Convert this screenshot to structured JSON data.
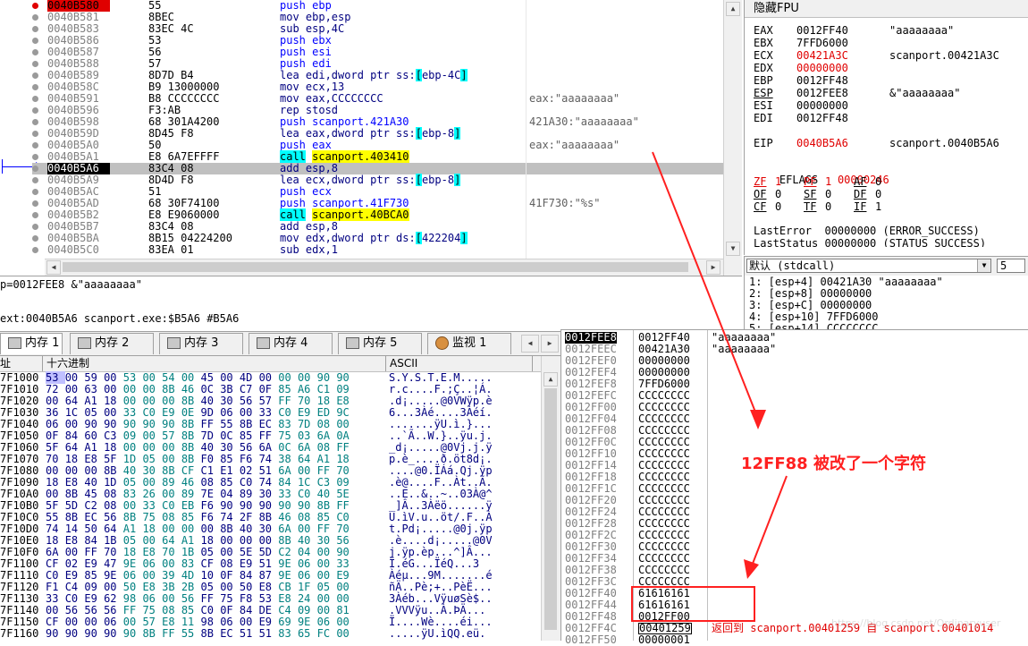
{
  "disasm": {
    "rows": [
      {
        "addr": "0040B580",
        "bytes": "55",
        "instr": "push ebp",
        "comment": ""
      },
      {
        "addr": "0040B581",
        "bytes": "8BEC",
        "instr": "mov ebp,esp",
        "comment": ""
      },
      {
        "addr": "0040B583",
        "bytes": "83EC 4C",
        "instr": "sub esp,4C",
        "comment": ""
      },
      {
        "addr": "0040B586",
        "bytes": "53",
        "instr": "push ebx",
        "comment": ""
      },
      {
        "addr": "0040B587",
        "bytes": "56",
        "instr": "push esi",
        "comment": ""
      },
      {
        "addr": "0040B588",
        "bytes": "57",
        "instr": "push edi",
        "comment": ""
      },
      {
        "addr": "0040B589",
        "bytes": "8D7D B4",
        "instr": "lea edi,dword ptr ss:[ebp-4C]",
        "comment": ""
      },
      {
        "addr": "0040B58C",
        "bytes": "B9 13000000",
        "instr": "mov ecx,13",
        "comment": ""
      },
      {
        "addr": "0040B591",
        "bytes": "B8 CCCCCCCC",
        "instr": "mov eax,CCCCCCCC",
        "comment": "eax:\"aaaaaaaa\""
      },
      {
        "addr": "0040B596",
        "bytes": "F3:AB",
        "instr": "rep stosd",
        "comment": ""
      },
      {
        "addr": "0040B598",
        "bytes": "68 301A4200",
        "instr": "push scanport.421A30",
        "comment": "421A30:\"aaaaaaaa\""
      },
      {
        "addr": "0040B59D",
        "bytes": "8D45 F8",
        "instr": "lea eax,dword ptr ss:[ebp-8]",
        "comment": ""
      },
      {
        "addr": "0040B5A0",
        "bytes": "50",
        "instr": "push eax",
        "comment": "eax:\"aaaaaaaa\""
      },
      {
        "addr": "0040B5A1",
        "bytes": "E8 6A7EFFFF",
        "instr": "call scanport.403410",
        "comment": ""
      },
      {
        "addr": "0040B5A6",
        "bytes": "83C4 08",
        "instr": "add esp,8",
        "comment": ""
      },
      {
        "addr": "0040B5A9",
        "bytes": "8D4D F8",
        "instr": "lea ecx,dword ptr ss:[ebp-8]",
        "comment": ""
      },
      {
        "addr": "0040B5AC",
        "bytes": "51",
        "instr": "push ecx",
        "comment": ""
      },
      {
        "addr": "0040B5AD",
        "bytes": "68 30F74100",
        "instr": "push scanport.41F730",
        "comment": "41F730:\"%s\""
      },
      {
        "addr": "0040B5B2",
        "bytes": "E8 E9060000",
        "instr": "call scanport.40BCA0",
        "comment": ""
      },
      {
        "addr": "0040B5B7",
        "bytes": "83C4 08",
        "instr": "add esp,8",
        "comment": ""
      },
      {
        "addr": "0040B5BA",
        "bytes": "8B15 04224200",
        "instr": "mov edx,dword ptr ds:[422204]",
        "comment": ""
      },
      {
        "addr": "0040B5C0",
        "bytes": "83EA 01",
        "instr": "sub edx,1",
        "comment": ""
      }
    ]
  },
  "info": {
    "line1": "p=0012FEE8 &\"aaaaaaaa\"",
    "line2": "ext:0040B5A6 scanport.exe:$B5A6 #B5A6"
  },
  "fpu": {
    "title": "隐藏FPU",
    "regs": [
      {
        "name": "EAX",
        "val": "0012FF40",
        "note": "\"aaaaaaaa\"",
        "red": false
      },
      {
        "name": "EBX",
        "val": "7FFD6000",
        "note": "",
        "red": false
      },
      {
        "name": "ECX",
        "val": "00421A3C",
        "note": "scanport.00421A3C",
        "red": true
      },
      {
        "name": "EDX",
        "val": "00000000",
        "note": "",
        "red": true
      },
      {
        "name": "EBP",
        "val": "0012FF48",
        "note": "",
        "red": false
      },
      {
        "name": "ESP",
        "val": "0012FEE8",
        "note": "&\"aaaaaaaa\"",
        "red": false
      },
      {
        "name": "ESI",
        "val": "00000000",
        "note": "",
        "red": false
      },
      {
        "name": "EDI",
        "val": "0012FF48",
        "note": "",
        "red": false
      }
    ],
    "eip": {
      "name": "EIP",
      "val": "0040B5A6",
      "note": "scanport.0040B5A6"
    },
    "eflags": {
      "name": "EFLAGS",
      "val": "00000246"
    },
    "flags": [
      [
        "ZF",
        "1",
        "PF",
        "1",
        "AF",
        "0"
      ],
      [
        "OF",
        "0",
        "SF",
        "0",
        "DF",
        "0"
      ],
      [
        "CF",
        "0",
        "TF",
        "0",
        "IF",
        "1"
      ]
    ],
    "lasterror": "LastError  00000000 (ERROR_SUCCESS)",
    "laststatus": "LastStatus 00000000 (STATUS_SUCCESS)",
    "callconv": "默认 (stdcall)",
    "argcount": "5",
    "args": [
      "1: [esp+4] 00421A30 \"aaaaaaaa\"",
      "2: [esp+8] 00000000",
      "3: [esp+C] 00000000",
      "4: [esp+10] 7FFD6000",
      "5: [esp+14] CCCCCCCC"
    ]
  },
  "tabs": [
    {
      "label": "内存 1",
      "icon": "memory-icon"
    },
    {
      "label": "内存 2",
      "icon": "memory-icon"
    },
    {
      "label": "内存 3",
      "icon": "memory-icon"
    },
    {
      "label": "内存 4",
      "icon": "memory-icon"
    },
    {
      "label": "内存 5",
      "icon": "memory-icon"
    },
    {
      "label": "监视 1",
      "icon": "watch-icon"
    }
  ],
  "dump": {
    "col_addr": "址",
    "col_hex": "十六进制",
    "col_ascii": "ASCII",
    "rows": [
      {
        "addr": "7F1000",
        "hex": "53 00 59 00 53 00 54 00 45 00 4D 00 00 00 90 90",
        "ascii": "S.Y.S.T.E.M....."
      },
      {
        "addr": "7F1010",
        "hex": "72 00 63 00 00 00 8B 46 0C 3B C7 0F 85 A6 C1 09",
        "ascii": "r.c....F.;Ç..¦Á."
      },
      {
        "addr": "7F1020",
        "hex": "00 64 A1 18 00 00 00 8B 40 30 56 57 FF 70 18 E8",
        "ascii": ".d¡.....@0VWÿp.è"
      },
      {
        "addr": "7F1030",
        "hex": "36 1C 05 00 33 C0 E9 0E 9D 06 00 33 C0 E9 ED 9C",
        "ascii": "6...3Àé....3Àéí."
      },
      {
        "addr": "7F1040",
        "hex": "06 00 90 90 90 90 90 8B FF 55 8B EC 83 7D 08 00",
        "ascii": ".......ÿU.ì.}..."
      },
      {
        "addr": "7F1050",
        "hex": "0F 84 60 C3 09 00 57 8B 7D 0C 85 FF 75 03 6A 0A",
        "ascii": "..`Ã..W.}..ÿu.j."
      },
      {
        "addr": "7F1060",
        "hex": "5F 64 A1 18 00 00 00 8B 40 30 56 6A 0C 6A 08 FF",
        "ascii": "_d¡.....@0Vj.j.ÿ"
      },
      {
        "addr": "7F1070",
        "hex": "70 18 E8 5F 1D 05 00 8B F0 85 F6 74 38 64 A1 18",
        "ascii": "p.è_....ð.öt8d¡."
      },
      {
        "addr": "7F1080",
        "hex": "00 00 00 8B 40 30 8B CF C1 E1 02 51 6A 00 FF 70",
        "ascii": "....@0.ÏÁá.Qj.ÿp"
      },
      {
        "addr": "7F1090",
        "hex": "18 E8 40 1D 05 00 89 46 08 85 C0 74 84 1C C3 09",
        "ascii": ".è@....F..Àt..Ã."
      },
      {
        "addr": "7F10A0",
        "hex": "00 8B 45 08 83 26 00 89 7E 04 89 30 33 C0 40 5E",
        "ascii": "..E..&..~..03À@^"
      },
      {
        "addr": "7F10B0",
        "hex": "5F 5D C2 08 00 33 C0 EB F6 90 90 90 90 90 8B FF",
        "ascii": "_]Â..3Àëö......ÿ"
      },
      {
        "addr": "7F10C0",
        "hex": "55 8B EC 56 8B 75 08 85 F6 74 2F 8B 46 08 85 C0",
        "ascii": "U.ìV.u..öt/.F..À"
      },
      {
        "addr": "7F10D0",
        "hex": "74 14 50 64 A1 18 00 00 00 8B 40 30 6A 00 FF 70",
        "ascii": "t.Pd¡.....@0j.ÿp"
      },
      {
        "addr": "7F10E0",
        "hex": "18 E8 84 1B 05 00 64 A1 18 00 00 00 8B 40 30 56",
        "ascii": ".è....d¡.....@0V"
      },
      {
        "addr": "7F10F0",
        "hex": "6A 00 FF 70 18 E8 70 1B 05 00 5E 5D C2 04 00 90",
        "ascii": "j.ÿp.èp...^]Â..."
      },
      {
        "addr": "7F1100",
        "hex": "CF 02 E9 47 9E 06 00 83 CF 08 E9 51 9E 06 00 33",
        "ascii": "Ï.éG...ÏéQ...3"
      },
      {
        "addr": "7F1110",
        "hex": "C0 E9 85 9E 06 00 39 4D 10 0F 84 87 9E 06 00 E9",
        "ascii": "Àéµ...9M.......é"
      },
      {
        "addr": "7F1120",
        "hex": "F1 C4 09 00 50 E8 3B 2B 05 00 50 E8 CB 1F 05 00",
        "ascii": "ñÄ..Pè;+..PèË..."
      },
      {
        "addr": "7F1130",
        "hex": "33 C0 E9 62 98 06 00 56 FF 75 F8 53 E8 24 00 00",
        "ascii": "3Àéb...VÿuøSè$.."
      },
      {
        "addr": "7F1140",
        "hex": "00 56 56 56 FF 75 08 85 C0 0F 84 DE C4 09 00 81",
        "ascii": ".VVVÿu..À.ÞÄ..."
      },
      {
        "addr": "7F1150",
        "hex": "CF 00 00 06 00 57 E8 11 98 06 00 E9 69 9E 06 00",
        "ascii": "Ï....Wè....éi..."
      },
      {
        "addr": "7F1160",
        "hex": "90 90 90 90 90 8B FF 55 8B EC 51 51 83 65 FC 00",
        "ascii": ".....ÿU.ìQQ.eü."
      }
    ]
  },
  "stack": {
    "rows": [
      {
        "addr": "0012FEE8",
        "val": "0012FF40",
        "note": "\"aaaaaaaa\""
      },
      {
        "addr": "0012FEEC",
        "val": "00421A30",
        "note": "\"aaaaaaaa\""
      },
      {
        "addr": "0012FEF0",
        "val": "00000000",
        "note": ""
      },
      {
        "addr": "0012FEF4",
        "val": "00000000",
        "note": ""
      },
      {
        "addr": "0012FEF8",
        "val": "7FFD6000",
        "note": ""
      },
      {
        "addr": "0012FEFC",
        "val": "CCCCCCCC",
        "note": ""
      },
      {
        "addr": "0012FF00",
        "val": "CCCCCCCC",
        "note": ""
      },
      {
        "addr": "0012FF04",
        "val": "CCCCCCCC",
        "note": ""
      },
      {
        "addr": "0012FF08",
        "val": "CCCCCCCC",
        "note": ""
      },
      {
        "addr": "0012FF0C",
        "val": "CCCCCCCC",
        "note": ""
      },
      {
        "addr": "0012FF10",
        "val": "CCCCCCCC",
        "note": ""
      },
      {
        "addr": "0012FF14",
        "val": "CCCCCCCC",
        "note": ""
      },
      {
        "addr": "0012FF18",
        "val": "CCCCCCCC",
        "note": ""
      },
      {
        "addr": "0012FF1C",
        "val": "CCCCCCCC",
        "note": ""
      },
      {
        "addr": "0012FF20",
        "val": "CCCCCCCC",
        "note": ""
      },
      {
        "addr": "0012FF24",
        "val": "CCCCCCCC",
        "note": ""
      },
      {
        "addr": "0012FF28",
        "val": "CCCCCCCC",
        "note": ""
      },
      {
        "addr": "0012FF2C",
        "val": "CCCCCCCC",
        "note": ""
      },
      {
        "addr": "0012FF30",
        "val": "CCCCCCCC",
        "note": ""
      },
      {
        "addr": "0012FF34",
        "val": "CCCCCCCC",
        "note": ""
      },
      {
        "addr": "0012FF38",
        "val": "CCCCCCCC",
        "note": ""
      },
      {
        "addr": "0012FF3C",
        "val": "CCCCCCCC",
        "note": ""
      },
      {
        "addr": "0012FF40",
        "val": "61616161",
        "note": ""
      },
      {
        "addr": "0012FF44",
        "val": "61616161",
        "note": ""
      },
      {
        "addr": "0012FF48",
        "val": "0012FF00",
        "note": ""
      },
      {
        "addr": "0012FF4C",
        "val": "00401259",
        "note": "返回到 scanport.00401259 自 scanport.00401014"
      },
      {
        "addr": "0012FF50",
        "val": "00000001",
        "note": ""
      }
    ]
  },
  "annotation": {
    "text": "12FF88 被改了一个字符",
    "color": "#ff2020"
  },
  "watermark": "https://blog.csdn.net/Ordinaryuser"
}
